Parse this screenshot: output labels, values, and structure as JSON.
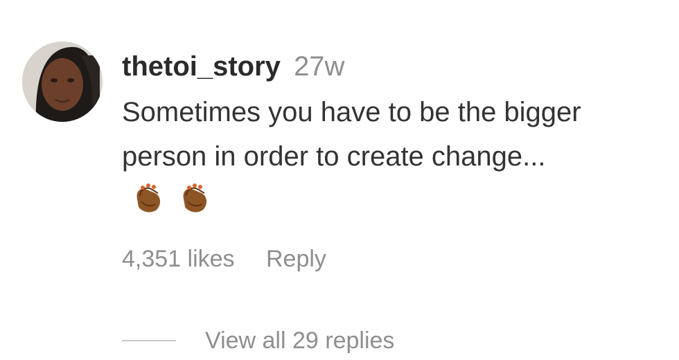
{
  "comment": {
    "username": "thetoi_story",
    "timestamp": "27w",
    "text": "Sometimes you have to be the bigger person in order to create change...",
    "emoji": [
      "clapping-hands-medium-dark",
      "clapping-hands-medium-dark"
    ],
    "likes": "4,351 likes",
    "reply_label": "Reply",
    "view_replies_label": "View all 29 replies"
  },
  "colors": {
    "username": "#2b2b2b",
    "text": "#333333",
    "muted": "#8e8e8e",
    "rule": "#c7c7c7",
    "emoji_skin": "#8d5524"
  }
}
